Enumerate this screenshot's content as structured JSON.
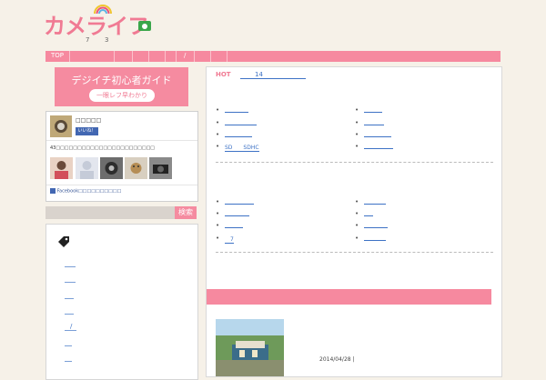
{
  "header": {
    "logo_text": "カメライフ",
    "sub_numbers": [
      "7",
      "3"
    ]
  },
  "nav": {
    "items": [
      {
        "label": "TOP"
      },
      {
        "label": ""
      },
      {
        "label": ""
      },
      {
        "label": ""
      },
      {
        "label": ""
      },
      {
        "label": ""
      },
      {
        "label": "/"
      },
      {
        "label": ""
      },
      {
        "label": ""
      },
      {
        "label": ""
      }
    ]
  },
  "sidebar": {
    "guide": {
      "title": "デジイチ初心者ガイド",
      "button_label": "一眼レフ早わかり"
    },
    "facebook": {
      "page_name": "□□□□□",
      "like_label": "いいね！",
      "count_text": "43□□□□□□□□□□□□□□□□□□□□□□□",
      "footer_text": "Facebook□□□□□□□□□□"
    },
    "search": {
      "button_label": "検索"
    },
    "tags": {
      "icon": "tag-icon",
      "items": [
        "",
        "",
        "",
        "",
        "/",
        "",
        ""
      ]
    }
  },
  "main": {
    "hot_label": "HOT",
    "hot_count": "14",
    "section1": {
      "left": [
        {
          "text": ""
        },
        {
          "text": ""
        },
        {
          "text": ""
        },
        {
          "text": "SD　　SDHC"
        }
      ],
      "right": [
        {
          "text": ""
        },
        {
          "text": ""
        },
        {
          "text": ""
        },
        {
          "text": ""
        }
      ]
    },
    "section2": {
      "left": [
        {
          "text": ""
        },
        {
          "text": ""
        },
        {
          "text": ""
        },
        {
          "text": "　7"
        }
      ],
      "right": [
        {
          "text": ""
        },
        {
          "text": ""
        },
        {
          "text": ""
        },
        {
          "text": ""
        }
      ]
    },
    "post": {
      "date": "2014/04/28 |"
    }
  },
  "colors": {
    "accent": "#f6899f",
    "link": "#3d72c5",
    "background": "#f6f1e8"
  }
}
